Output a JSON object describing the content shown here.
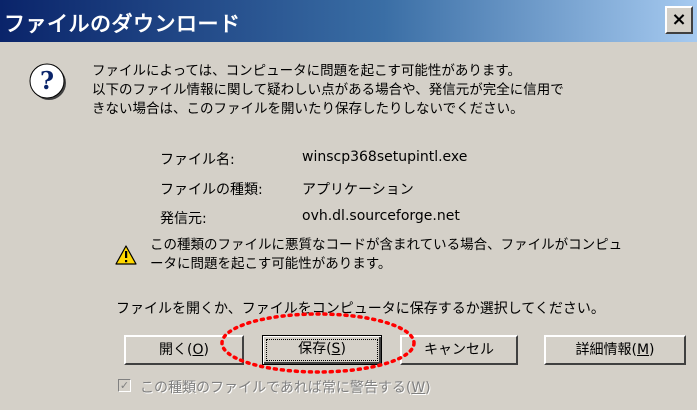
{
  "window": {
    "title": "ファイルのダウンロード",
    "close_label": "×"
  },
  "warning": {
    "lines": [
      "ファイルによっては、コンピュータに問題を起こす可能性があります。",
      "以下のファイル情報に関して疑わしい点がある場合や、発信元が完全に信用で",
      "きない場合は、このファイルを開いたり保存したりしないでください。"
    ]
  },
  "file_info": {
    "name_label": "ファイル名:",
    "name_value": "winscp368setupintl.exe",
    "type_label": "ファイルの種類:",
    "type_value": "アプリケーション",
    "publisher_label": "発信元:",
    "publisher_value": "ovh.dl.sourceforge.net"
  },
  "caution": {
    "lines": [
      "この種類のファイルに悪質なコードが含まれている場合、ファイルがコンピュ",
      "ータに問題を起こす可能性があります。"
    ]
  },
  "prompt": "ファイルを開くか、ファイルをコンピュータに保存するか選択してください。",
  "buttons": {
    "open": {
      "label": "開く(",
      "mnemonic": "O",
      "suffix": ")"
    },
    "save": {
      "label": "保存(",
      "mnemonic": "S",
      "suffix": ")"
    },
    "cancel": {
      "label": "キャンセル"
    },
    "details": {
      "label": "詳細情報(",
      "mnemonic": "M",
      "suffix": ")"
    }
  },
  "always_ask": {
    "checked": true,
    "check_glyph": "✓",
    "label": "この種類のファイルであれば常に警告する(",
    "mnemonic": "W",
    "suffix": ")"
  },
  "colors": {
    "title_gradient_start": "#0a246a",
    "title_gradient_end": "#a6caf0",
    "dialog_bg": "#d4d0c8",
    "highlight_circle": "#ff0000"
  },
  "icons": {
    "question": "question-icon",
    "warning": "warning-triangle-icon"
  }
}
